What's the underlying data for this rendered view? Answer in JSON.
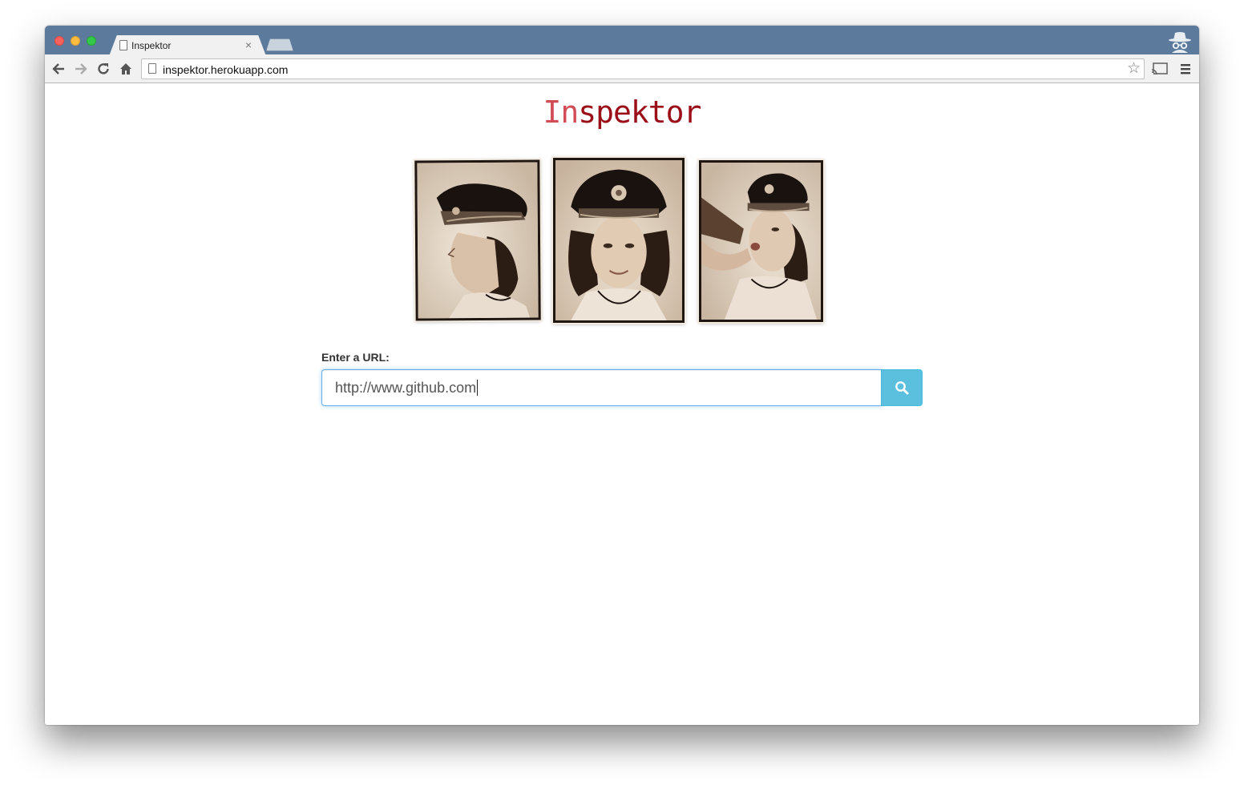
{
  "browser": {
    "tab": {
      "title": "Inspektor",
      "close_glyph": "×"
    },
    "address_bar": {
      "url": "inspektor.herokuapp.com"
    },
    "icons": [
      "back-arrow-icon",
      "forward-arrow-icon",
      "reload-icon",
      "home-icon",
      "page-icon",
      "star-icon",
      "cast-icon",
      "menu-icon",
      "incognito-icon"
    ],
    "nav_glyphs": {
      "back": "🡐",
      "forward": "🡒",
      "reload": "↻",
      "home": "⌂",
      "star": "☆"
    }
  },
  "page": {
    "brand": {
      "part1": "In",
      "part2": "spektor"
    },
    "brand_colors": {
      "part1": "#d24c56",
      "part2": "#9b1018"
    },
    "photos": [
      {
        "subject": "sepia portrait, profile wearing captain hat"
      },
      {
        "subject": "sepia portrait, front facing wearing captain hat"
      },
      {
        "subject": "sepia portrait, drinking from bottle wearing captain hat"
      }
    ],
    "form": {
      "label": "Enter a URL:",
      "input_value": "http://www.github.com",
      "search_button_icon": "search-icon"
    },
    "accent_color": "#5bc0de"
  }
}
